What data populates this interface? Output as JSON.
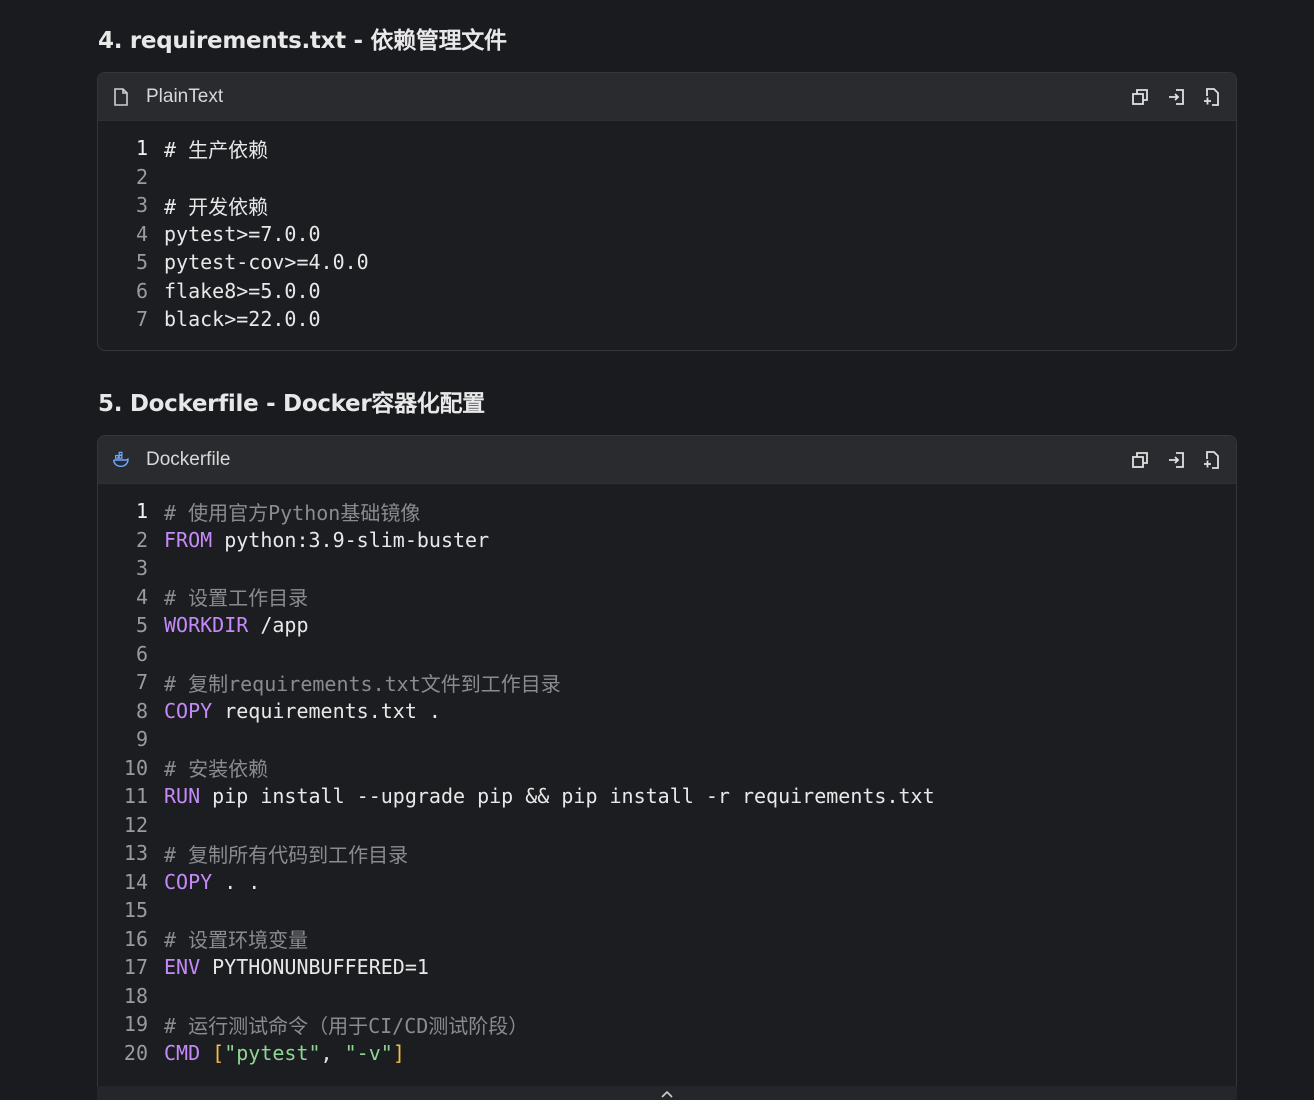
{
  "sections": [
    {
      "title": "4. requirements.txt - 依赖管理文件",
      "lang": "PlainText",
      "icon": "file-icon",
      "lines": [
        [
          {
            "t": "# 生产依赖",
            "c": "plain"
          }
        ],
        [],
        [
          {
            "t": "# 开发依赖",
            "c": "plain"
          }
        ],
        [
          {
            "t": "pytest>=7.0.0",
            "c": "plain"
          }
        ],
        [
          {
            "t": "pytest-cov>=4.0.0",
            "c": "plain"
          }
        ],
        [
          {
            "t": "flake8>=5.0.0",
            "c": "plain"
          }
        ],
        [
          {
            "t": "black>=22.0.0",
            "c": "plain"
          }
        ]
      ]
    },
    {
      "title": "5. Dockerfile - Docker容器化配置",
      "lang": "Dockerfile",
      "icon": "docker-icon",
      "lines": [
        [
          {
            "t": "# 使用官方Python基础镜像",
            "c": "comment"
          }
        ],
        [
          {
            "t": "FROM",
            "c": "kw"
          },
          {
            "t": " python:3.9-slim-buster",
            "c": "plain"
          }
        ],
        [],
        [
          {
            "t": "# 设置工作目录",
            "c": "comment"
          }
        ],
        [
          {
            "t": "WORKDIR",
            "c": "kw"
          },
          {
            "t": " /app",
            "c": "plain"
          }
        ],
        [],
        [
          {
            "t": "# 复制requirements.txt文件到工作目录",
            "c": "comment"
          }
        ],
        [
          {
            "t": "COPY",
            "c": "kw"
          },
          {
            "t": " requirements.txt .",
            "c": "plain"
          }
        ],
        [],
        [
          {
            "t": "# 安装依赖",
            "c": "comment"
          }
        ],
        [
          {
            "t": "RUN",
            "c": "kw"
          },
          {
            "t": " pip install --upgrade pip && pip install -r requirements.txt",
            "c": "plain"
          }
        ],
        [],
        [
          {
            "t": "# 复制所有代码到工作目录",
            "c": "comment"
          }
        ],
        [
          {
            "t": "COPY",
            "c": "kw"
          },
          {
            "t": " . .",
            "c": "plain"
          }
        ],
        [],
        [
          {
            "t": "# 设置环境变量",
            "c": "comment"
          }
        ],
        [
          {
            "t": "ENV",
            "c": "kw"
          },
          {
            "t": " PYTHONUNBUFFERED=1",
            "c": "plain"
          }
        ],
        [],
        [
          {
            "t": "# 运行测试命令（用于CI/CD测试阶段）",
            "c": "comment"
          }
        ],
        [
          {
            "t": "CMD",
            "c": "kw"
          },
          {
            "t": " ",
            "c": "plain"
          },
          {
            "t": "[",
            "c": "bracket"
          },
          {
            "t": "\"pytest\"",
            "c": "str"
          },
          {
            "t": ", ",
            "c": "plain"
          },
          {
            "t": "\"-v\"",
            "c": "str"
          },
          {
            "t": "]",
            "c": "bracket"
          }
        ]
      ]
    }
  ],
  "actions": [
    "copy-icon",
    "insert-icon",
    "new-file-icon"
  ]
}
